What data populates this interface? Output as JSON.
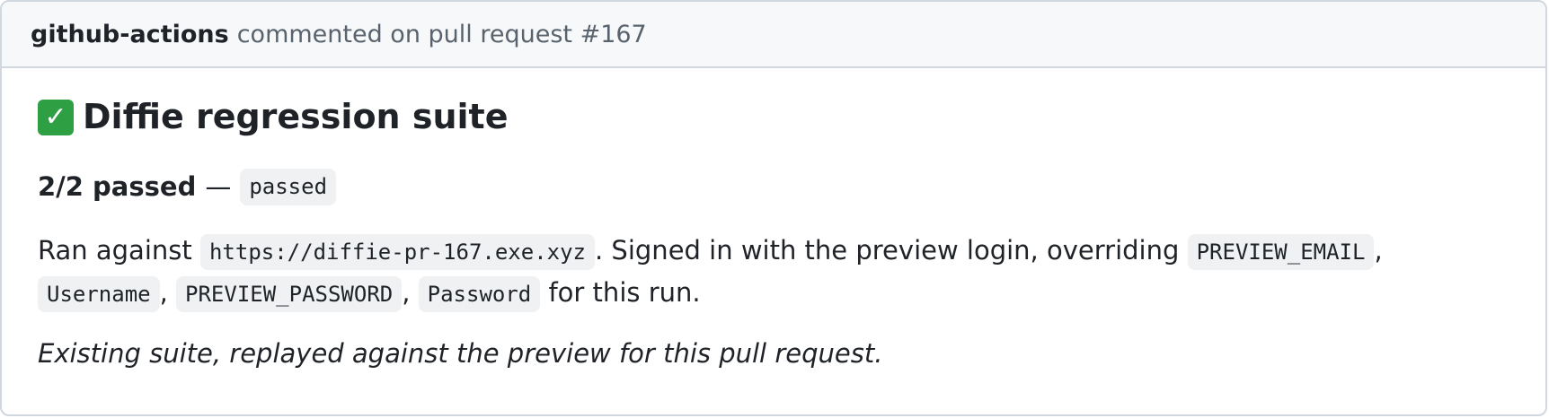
{
  "comment": {
    "author": "github-actions",
    "action": "commented on pull request #167",
    "title": "Diffie regression suite",
    "title_icon": "check-mark-button-icon",
    "status": {
      "count": "2/2 passed",
      "separator": "—",
      "badge": "passed"
    },
    "ran": {
      "prefix": "Ran against",
      "url": "https://diffie-pr-167.exe.xyz",
      "middle": ". Signed in with the preview login, overriding",
      "var1": "PREVIEW_EMAIL",
      "sep1": ",",
      "val1": "Username",
      "sep2": ",",
      "var2": "PREVIEW_PASSWORD",
      "sep3": ",",
      "val2": "Password",
      "suffix": "for this run."
    },
    "note": "Existing suite, replayed against the preview for this pull request.",
    "colors": {
      "header_bg": "#f6f8fa",
      "border": "#d0d7de",
      "code_bg": "#eff1f3",
      "check_green": "#2ea043",
      "text": "#1f2328",
      "muted": "#59636e"
    }
  }
}
